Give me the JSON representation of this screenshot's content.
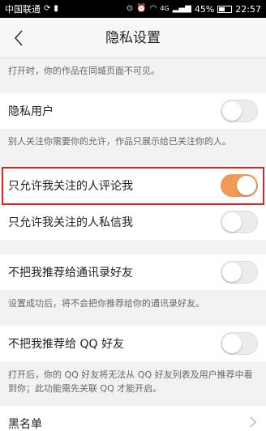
{
  "status_bar": {
    "carrier": "中国联通",
    "battery": "45%",
    "battery_level": 0.45,
    "time": "22:57",
    "signal_label": "4G"
  },
  "nav": {
    "title": "隐私设置"
  },
  "notes": {
    "top": "打开时，你的作品在同城页面不可见。",
    "private_user": "别人关注你需要你的允许，作品只展示给已关注你的人。",
    "contacts": "设置成功后，将不会把你推荐给你的通讯录好友。",
    "qq": "打开后，你的 QQ 好友将无法从 QQ 好友列表及用户推荐中看到你；此功能需先关联 QQ 才能开启。"
  },
  "settings": {
    "private_user": {
      "label": "隐私用户",
      "on": false
    },
    "comment_only_following": {
      "label": "只允许我关注的人评论我",
      "on": true
    },
    "message_only_following": {
      "label": "只允许我关注的人私信我",
      "on": false
    },
    "no_recommend_contacts": {
      "label": "不把我推荐给通讯录好友",
      "on": false
    },
    "no_recommend_qq": {
      "label": "不把我推荐给 QQ 好友",
      "on": false
    },
    "blacklist": {
      "label": "黑名单"
    }
  },
  "colors": {
    "accent": "#f19a55",
    "highlight": "#e0211f"
  }
}
